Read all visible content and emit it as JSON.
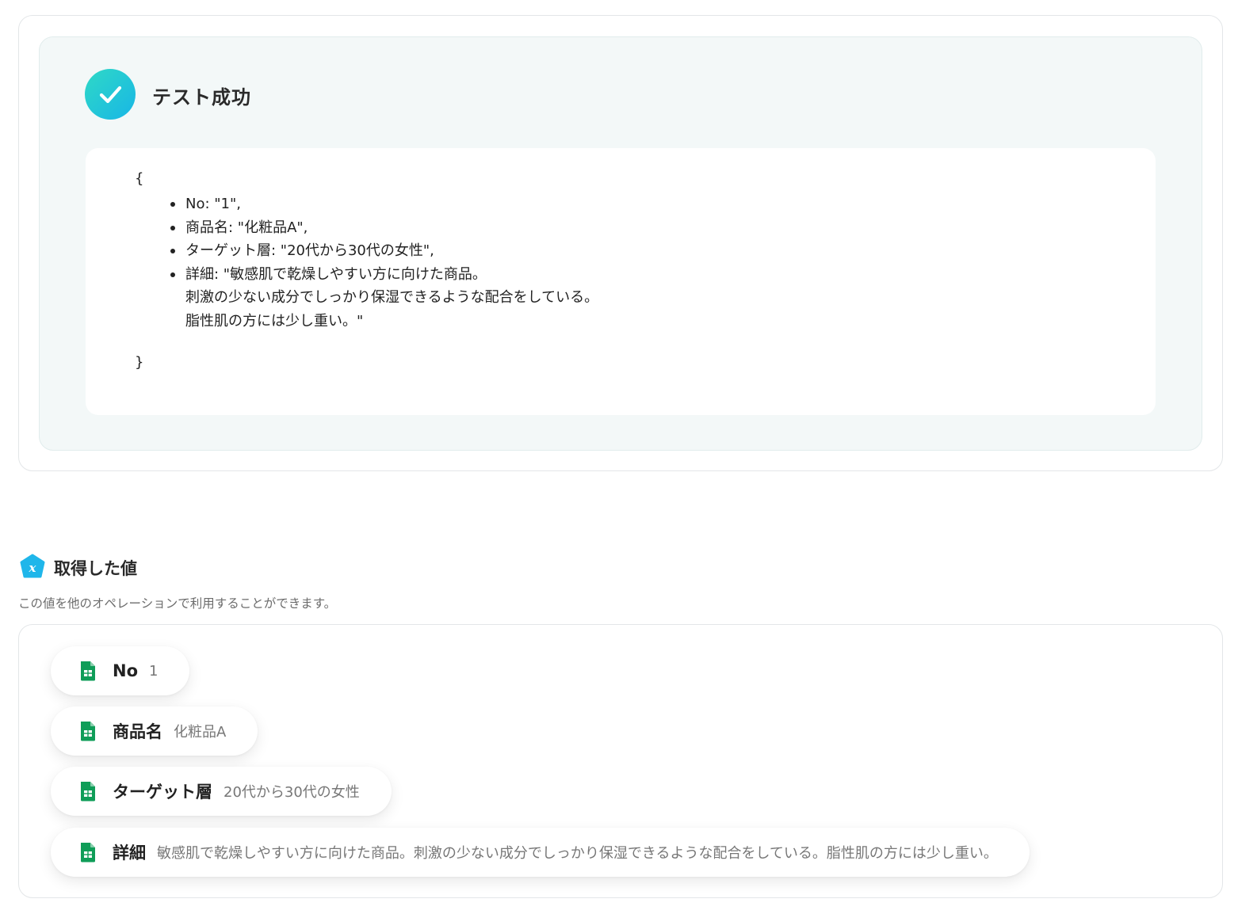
{
  "test_result": {
    "title": "テスト成功",
    "open_brace": "{",
    "close_brace": "}",
    "fields": [
      {
        "lines": [
          "No: \"1\","
        ]
      },
      {
        "lines": [
          "商品名: \"化粧品A\","
        ]
      },
      {
        "lines": [
          "ターゲット層: \"20代から30代の女性\","
        ]
      },
      {
        "lines": [
          "詳細: \"敏感肌で乾燥しやすい方に向けた商品。",
          "刺激の少ない成分でしっかり保湿できるような配合をしている。",
          "脂性肌の方には少し重い。\""
        ]
      }
    ]
  },
  "acquired_values": {
    "title": "取得した値",
    "description": "この値を他のオペレーションで利用することができます。",
    "items": [
      {
        "key": "No",
        "value": "1"
      },
      {
        "key": "商品名",
        "value": "化粧品A"
      },
      {
        "key": "ターゲット層",
        "value": "20代から30代の女性"
      },
      {
        "key": "詳細",
        "value": "敏感肌で乾燥しやすい方に向けた商品。刺激の少ない成分でしっかり保湿できるような配合をしている。脂性肌の方には少し重い。"
      }
    ]
  },
  "icons": {
    "success": "check-circle-icon",
    "section": "variable-icon",
    "item": "google-sheets-icon"
  },
  "colors": {
    "success_gradient_start": "#2fd9c6",
    "success_gradient_end": "#18b6e6",
    "section_icon": "#1fb6ea",
    "sheets_green": "#0f9d58"
  }
}
